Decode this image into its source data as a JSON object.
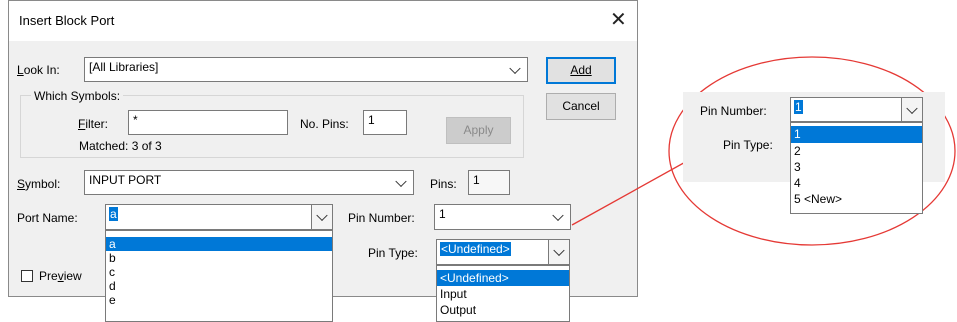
{
  "dialog": {
    "title": "Insert Block Port",
    "close_glyph": "✕",
    "look_in": {
      "label": "Look In:",
      "value": "[All Libraries]"
    },
    "which_symbols": {
      "label": "Which Symbols:",
      "filter_label": "Filter:",
      "filter_value": "*",
      "no_pins_label": "No. Pins:",
      "no_pins_value": "1",
      "apply_label": "Apply",
      "matched": "Matched: 3 of 3"
    },
    "add_label": "Add",
    "cancel_label": "Cancel",
    "symbol": {
      "label": "Symbol:",
      "value": "INPUT PORT"
    },
    "pins": {
      "label": "Pins:",
      "value": "1"
    },
    "port_name": {
      "label": "Port Name:",
      "value": "a",
      "options": [
        "a",
        "b",
        "c",
        "d",
        "e"
      ],
      "selected_index": 0
    },
    "pin_number": {
      "label": "Pin Number:",
      "value": "1"
    },
    "pin_type": {
      "label": "Pin Type:",
      "value": "<Undefined>",
      "options": [
        "<Undefined>",
        "Input",
        "Output"
      ],
      "selected_index": 0
    },
    "preview_label": "Preview"
  },
  "zoom": {
    "pin_number_label": "Pin Number:",
    "pin_number_value": "1",
    "pin_type_label": "Pin Type:",
    "options": [
      "1",
      "2",
      "3",
      "4",
      "5 <New>"
    ],
    "selected_index": 0
  },
  "colors": {
    "accent": "#0078d7",
    "annotation": "#e53935",
    "dialog_bg": "#f0f0f0"
  }
}
